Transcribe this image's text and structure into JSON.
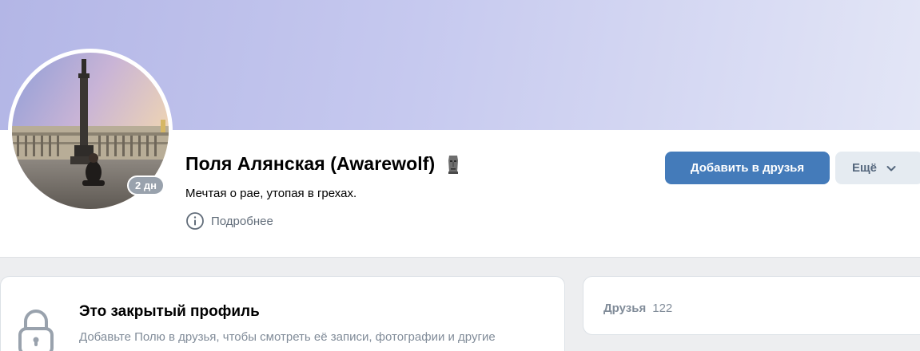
{
  "profile": {
    "name": "Поля Алянская (Awarewolf)",
    "status": "Мечтая о рае, утопая в грехах.",
    "online_badge": "2 дн",
    "more_info_label": "Подробнее",
    "emoji_status_icon": "moai-icon",
    "cover_colors": [
      "#b3b6e6",
      "#e3e6f6"
    ]
  },
  "actions": {
    "add_friend_label": "Добавить в друзья",
    "more_label": "Ещё"
  },
  "closed_profile": {
    "title": "Это закрытый профиль",
    "description": "Добавьте Полю в друзья, чтобы смотреть её записи, фотографии и другие материалы."
  },
  "friends": {
    "label": "Друзья",
    "count": "122"
  },
  "colors": {
    "primary_button": "#447bba",
    "secondary_button": "#e5ebf1",
    "muted_text": "#818c99",
    "background": "#edeef0"
  }
}
